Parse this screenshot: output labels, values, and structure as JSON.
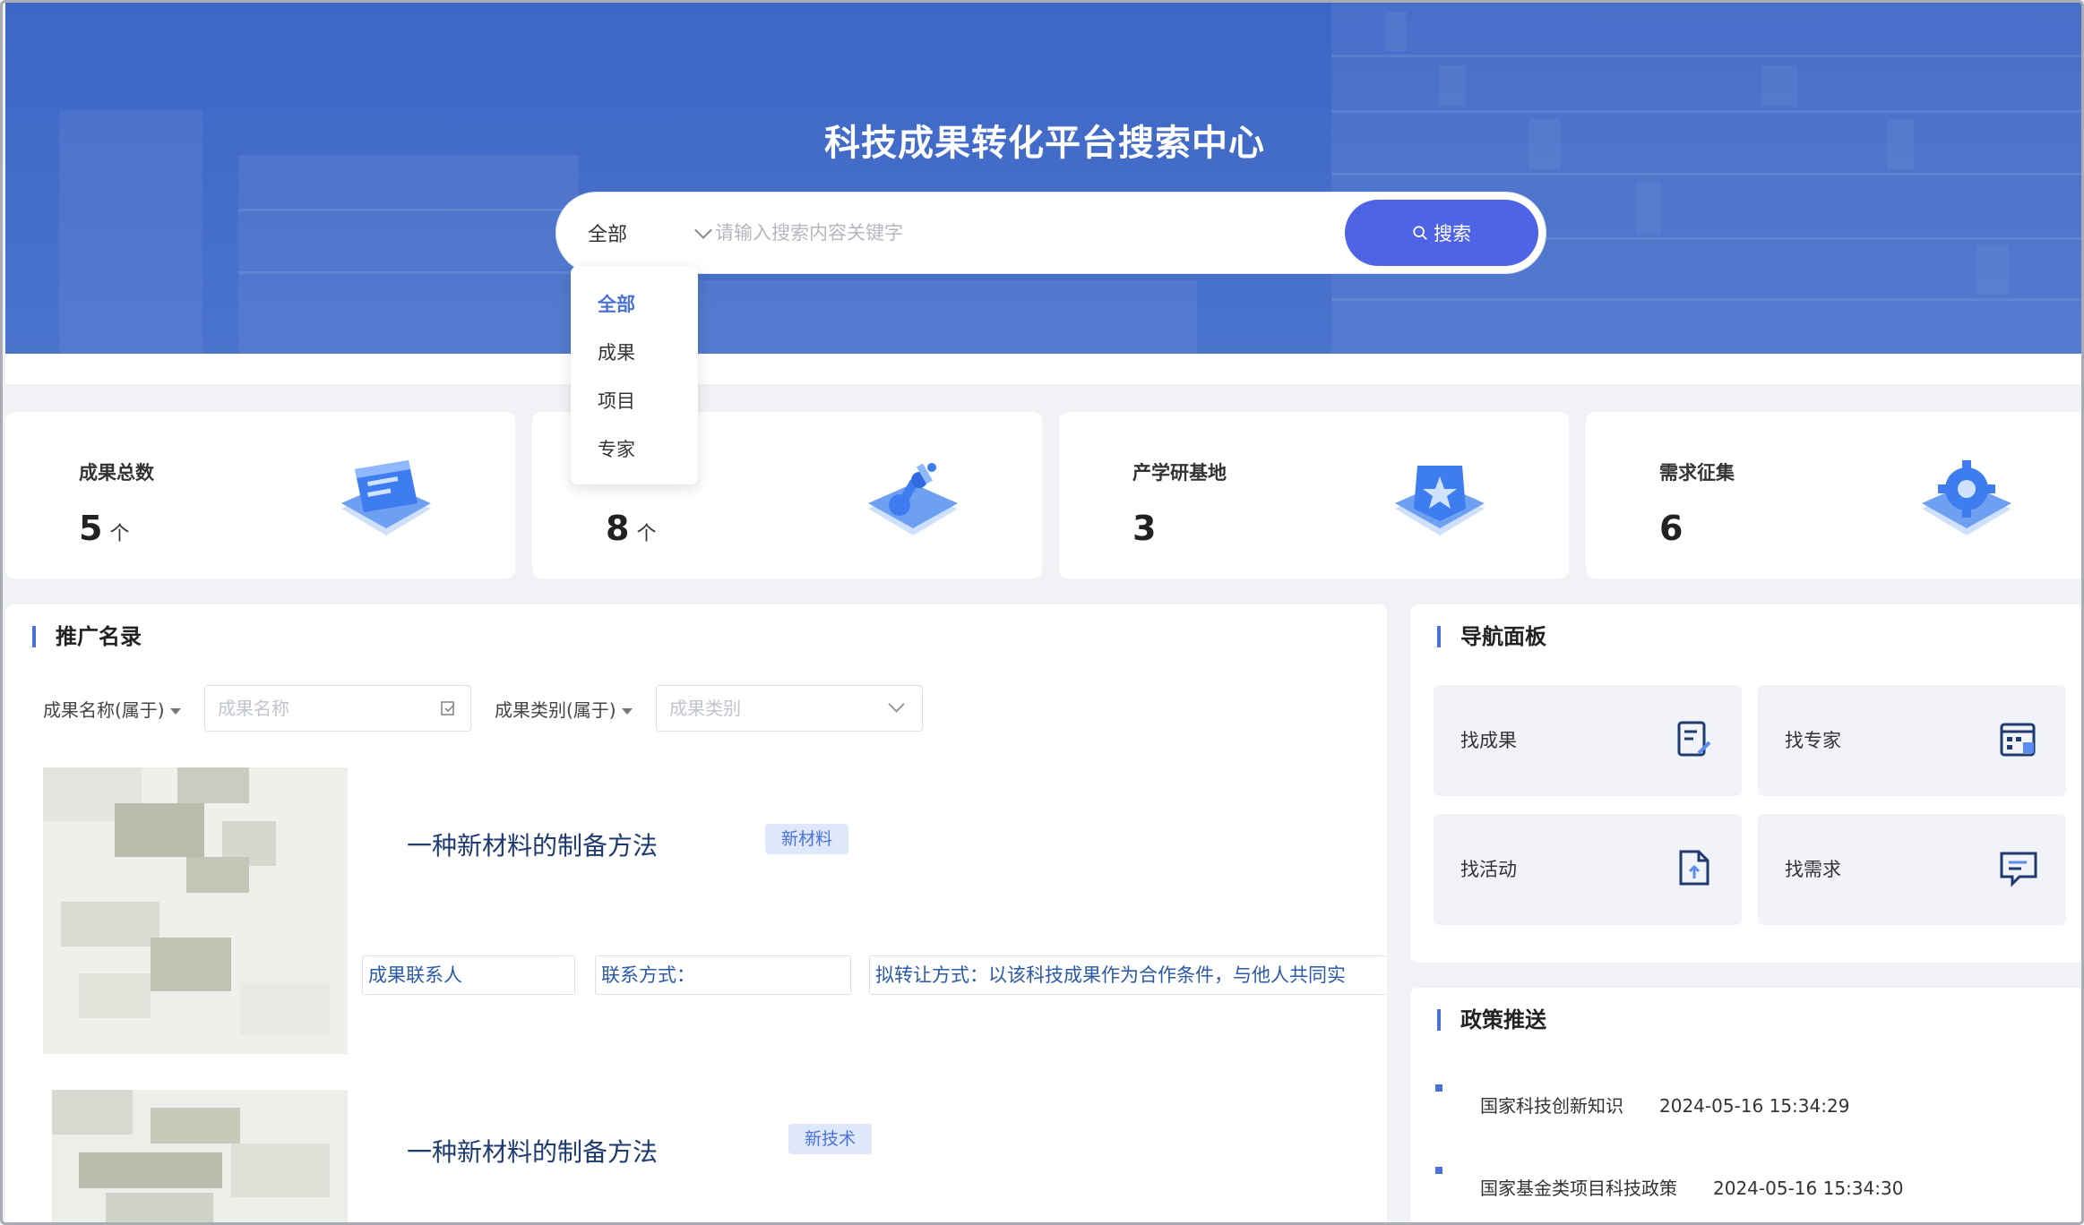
{
  "hero": {
    "title": "科技成果转化平台搜索中心",
    "select_value": "全部",
    "placeholder": "请输入搜索内容关键字",
    "search_label": "搜索"
  },
  "dropdown": {
    "options": [
      "全部",
      "成果",
      "项目",
      "专家"
    ],
    "selected": "全部"
  },
  "stats": [
    {
      "label": "成果总数",
      "value": "5",
      "unit": "个"
    },
    {
      "label": "",
      "value": "8",
      "unit": "个"
    },
    {
      "label": "产学研基地",
      "value": "3",
      "unit": ""
    },
    {
      "label": "需求征集",
      "value": "6",
      "unit": ""
    }
  ],
  "directory": {
    "title": "推广名录",
    "filter1_label": "成果名称(属于)",
    "filter1_placeholder": "成果名称",
    "filter2_label": "成果类别(属于)",
    "filter2_placeholder": "成果类别",
    "items": [
      {
        "title": "一种新材料的制备方法",
        "tag": "新材料",
        "contact": "成果联系人",
        "phone": "联系方式：",
        "transfer": "拟转让方式：以该科技成果作为合作条件，与他人共同实"
      },
      {
        "title": "一种新材料的制备方法",
        "tag": "新技术"
      }
    ]
  },
  "nav_panel": {
    "title": "导航面板",
    "tiles": [
      {
        "label": "找成果",
        "icon": "document-edit-icon"
      },
      {
        "label": "找专家",
        "icon": "calendar-list-icon"
      },
      {
        "label": "找活动",
        "icon": "file-upload-icon"
      },
      {
        "label": "找需求",
        "icon": "message-icon"
      }
    ]
  },
  "policy": {
    "title": "政策推送",
    "items": [
      {
        "name": "国家科技创新知识",
        "date": "2024-05-16 15:34:29"
      },
      {
        "name": "国家基金类项目科技政策",
        "date": "2024-05-16 15:34:30"
      }
    ]
  },
  "colors": {
    "hero": "#3d67c6",
    "accent": "#4b72d8",
    "button": "#4f63e6"
  }
}
